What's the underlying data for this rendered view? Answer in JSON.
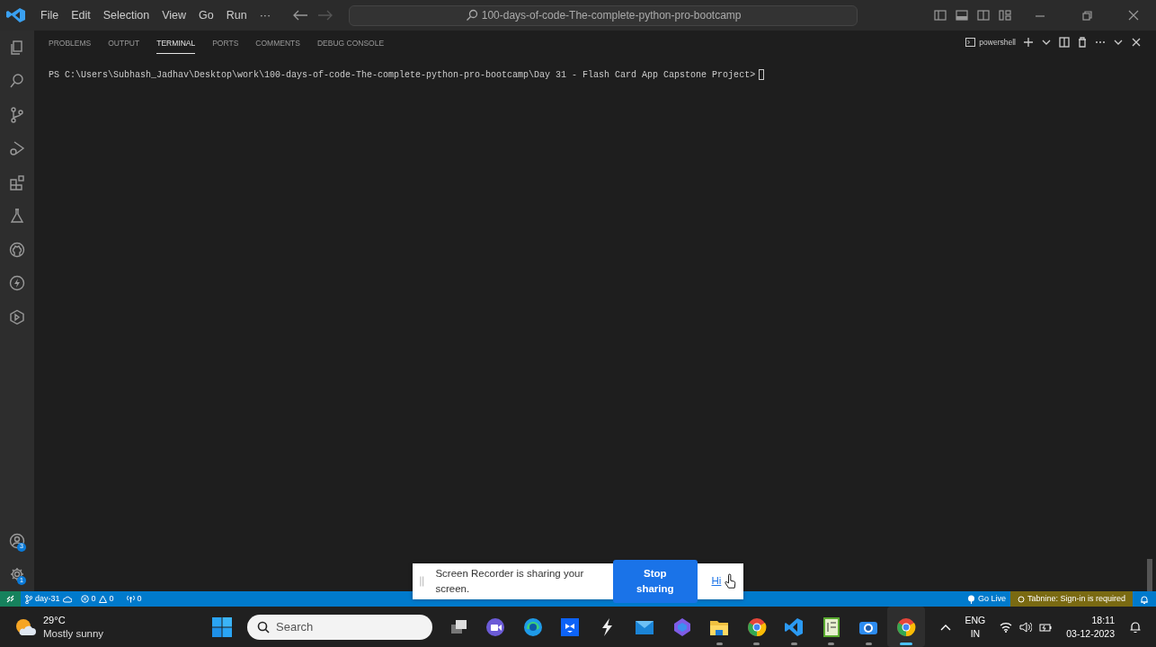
{
  "title_bar": {
    "menu": [
      "File",
      "Edit",
      "Selection",
      "View",
      "Go",
      "Run",
      "···"
    ],
    "command_center": "100-days-of-code-The-complete-python-pro-bootcamp"
  },
  "activity_bar": {
    "top": [
      {
        "kind": "files"
      },
      {
        "kind": "search"
      },
      {
        "kind": "source-control"
      },
      {
        "kind": "run"
      },
      {
        "kind": "extensions"
      },
      {
        "kind": "flask"
      },
      {
        "kind": "github"
      },
      {
        "kind": "bolt"
      },
      {
        "kind": "hexagon"
      }
    ],
    "bottom": [
      {
        "kind": "account",
        "badge": "3"
      },
      {
        "kind": "settings",
        "badge": "1"
      }
    ]
  },
  "panel": {
    "tabs": [
      {
        "label": "PROBLEMS",
        "selected": false
      },
      {
        "label": "OUTPUT",
        "selected": false
      },
      {
        "label": "TERMINAL",
        "selected": true
      },
      {
        "label": "PORTS",
        "selected": false
      },
      {
        "label": "COMMENTS",
        "selected": false
      },
      {
        "label": "DEBUG CONSOLE",
        "selected": false
      }
    ],
    "terminal_profile": "powershell",
    "terminal_line": "PS C:\\Users\\Subhash_Jadhav\\Desktop\\work\\100-days-of-code-The-complete-python-pro-bootcamp\\Day 31 - Flash Card App Capstone Project>"
  },
  "sharing_bar": {
    "message": "Screen Recorder is sharing your screen.",
    "button": "Stop sharing",
    "link": "Hi"
  },
  "status_bar": {
    "branch": "day-31",
    "errors": "0",
    "warnings": "0",
    "ports": "0",
    "go_live": "Go Live",
    "tabnine": "Tabnine: Sign-in is required"
  },
  "taskbar": {
    "weather_temp": "29°C",
    "weather_text": "Mostly sunny",
    "search_placeholder": "Search",
    "apps": [
      {
        "kind": "task-view",
        "running": false,
        "selected": false
      },
      {
        "kind": "meet",
        "running": false,
        "selected": false
      },
      {
        "kind": "edge",
        "running": false,
        "selected": false
      },
      {
        "kind": "dropbox",
        "running": false,
        "selected": false
      },
      {
        "kind": "bolt",
        "running": false,
        "selected": false
      },
      {
        "kind": "mail",
        "running": false,
        "selected": false
      },
      {
        "kind": "copilot",
        "running": false,
        "selected": false
      },
      {
        "kind": "folder",
        "running": true,
        "selected": false
      },
      {
        "kind": "chrome",
        "running": true,
        "selected": false
      },
      {
        "kind": "vscode",
        "running": true,
        "selected": false
      },
      {
        "kind": "notepad",
        "running": true,
        "selected": false
      },
      {
        "kind": "camera",
        "running": true,
        "selected": false
      },
      {
        "kind": "chrome",
        "running": true,
        "selected": true
      }
    ],
    "language": "ENG",
    "region": "IN",
    "time": "18:11",
    "date": "03-12-2023"
  }
}
